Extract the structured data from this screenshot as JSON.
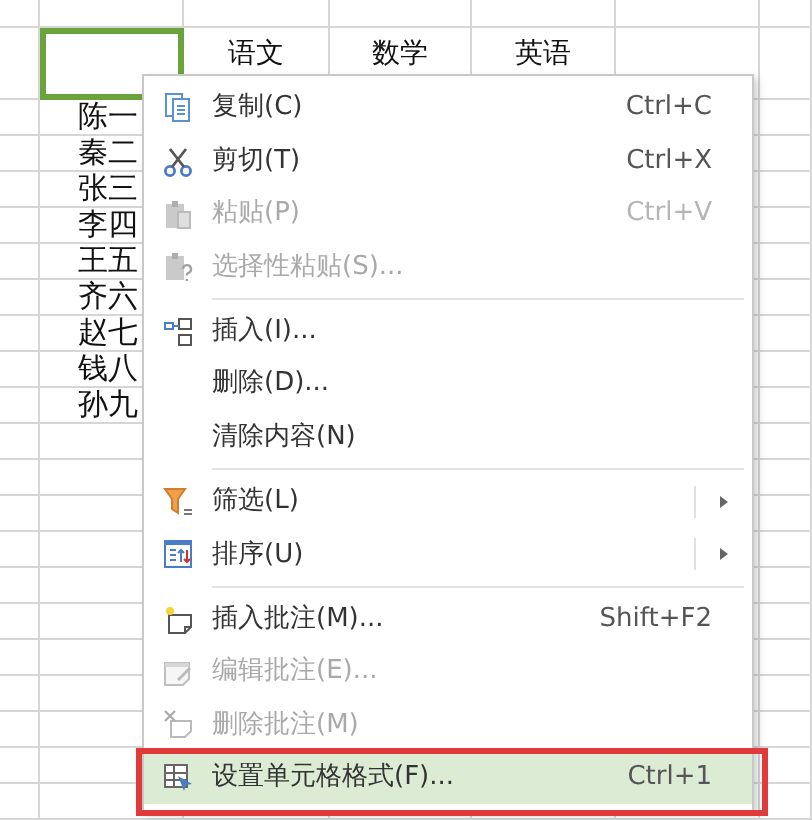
{
  "sheet": {
    "corner_cell_selected": true,
    "column_headers": [
      "语文",
      "数学",
      "英语"
    ],
    "names": [
      "陈一",
      "秦二",
      "张三",
      "李四",
      "王五",
      "齐六",
      "赵七",
      "钱八",
      "孙九"
    ]
  },
  "menu": {
    "items": [
      {
        "kind": "item",
        "label": "复制(C)",
        "shortcut": "Ctrl+C",
        "disabled": false,
        "submenu": false,
        "selected": false
      },
      {
        "kind": "item",
        "label": "剪切(T)",
        "shortcut": "Ctrl+X",
        "disabled": false,
        "submenu": false,
        "selected": false
      },
      {
        "kind": "item",
        "label": "粘贴(P)",
        "shortcut": "Ctrl+V",
        "disabled": true,
        "submenu": false,
        "selected": false
      },
      {
        "kind": "item",
        "label": "选择性粘贴(S)...",
        "disabled": true,
        "submenu": false,
        "selected": false
      },
      {
        "kind": "separator"
      },
      {
        "kind": "item",
        "label": "插入(I)...",
        "disabled": false,
        "submenu": false,
        "selected": false
      },
      {
        "kind": "item",
        "label": "删除(D)...",
        "disabled": false,
        "submenu": false,
        "selected": false
      },
      {
        "kind": "item",
        "label": "清除内容(N)",
        "disabled": false,
        "submenu": false,
        "selected": false
      },
      {
        "kind": "separator"
      },
      {
        "kind": "item",
        "label": "筛选(L)",
        "disabled": false,
        "submenu": true,
        "selected": false
      },
      {
        "kind": "item",
        "label": "排序(U)",
        "disabled": false,
        "submenu": true,
        "selected": false
      },
      {
        "kind": "separator"
      },
      {
        "kind": "item",
        "label": "插入批注(M)...",
        "shortcut": "Shift+F2",
        "disabled": false,
        "submenu": false,
        "selected": false
      },
      {
        "kind": "item",
        "label": "编辑批注(E)...",
        "disabled": true,
        "submenu": false,
        "selected": false
      },
      {
        "kind": "item",
        "label": "删除批注(M)",
        "disabled": true,
        "submenu": false,
        "selected": false
      },
      {
        "kind": "item",
        "label": "设置单元格格式(F)...",
        "shortcut": "Ctrl+1",
        "disabled": false,
        "submenu": false,
        "selected": true
      }
    ]
  }
}
